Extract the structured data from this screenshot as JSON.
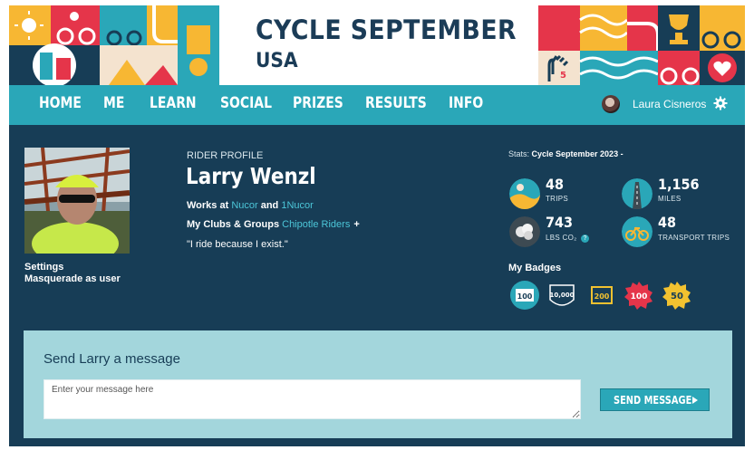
{
  "banner": {
    "title": "CYCLE SEPTEMBER",
    "subtitle": "USA",
    "badge_number": "5"
  },
  "nav": {
    "items": [
      {
        "label": "HOME"
      },
      {
        "label": "ME"
      },
      {
        "label": "LEARN"
      },
      {
        "label": "SOCIAL"
      },
      {
        "label": "PRIZES"
      },
      {
        "label": "RESULTS"
      },
      {
        "label": "INFO"
      }
    ],
    "user_name": "Laura Cisneros"
  },
  "sidebar": {
    "settings": "Settings",
    "masquerade": "Masquerade as user"
  },
  "profile": {
    "label": "RIDER PROFILE",
    "name": "Larry Wenzl",
    "works_prefix": "Works at ",
    "employer1": "Nucor",
    "works_and": " and ",
    "employer2": "1Nucor",
    "clubs_prefix": "My Clubs & Groups ",
    "club": "Chipotle Riders",
    "club_add": "+",
    "quote": "\"I ride because I exist.\""
  },
  "stats": {
    "prefix": "Stats: ",
    "period": "Cycle September 2023 -",
    "trips": {
      "value": "48",
      "label": "TRIPS"
    },
    "miles": {
      "value": "1,156",
      "label": "MILES"
    },
    "co2": {
      "value": "743",
      "label": "LBS CO₂"
    },
    "transport": {
      "value": "48",
      "label": "TRANSPORT TRIPS"
    }
  },
  "badges": {
    "heading": "My Badges",
    "items": [
      {
        "text": "100",
        "color": "#2aa7b8"
      },
      {
        "text": "10,000",
        "color": "#173d56"
      },
      {
        "text": "200",
        "color": "#f2c230"
      },
      {
        "text": "100",
        "color": "#e5354a"
      },
      {
        "text": "50",
        "color": "#f2c230"
      }
    ]
  },
  "message": {
    "title": "Send Larry a message",
    "placeholder": "Enter your message here",
    "button": "SEND MESSAGE"
  },
  "colors": {
    "teal": "#2aa7b8",
    "navy": "#173d56",
    "card": "#a3d6dc",
    "link": "#4cc6d8"
  }
}
